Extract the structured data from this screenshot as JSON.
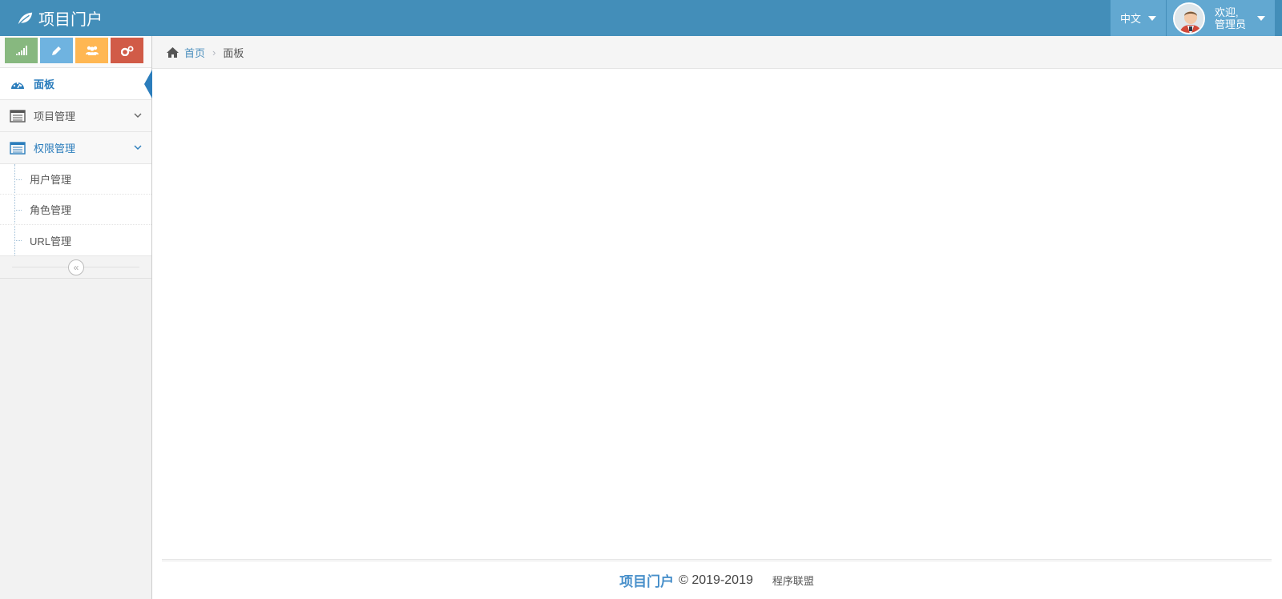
{
  "header": {
    "brand": "项目门户",
    "language": "中文",
    "user_greeting": "欢迎,",
    "user_name": "管理员"
  },
  "shortcuts": [
    {
      "icon": "signal-icon",
      "color": "#87b87f"
    },
    {
      "icon": "pencil-icon",
      "color": "#6fb3e0"
    },
    {
      "icon": "users-icon",
      "color": "#ffb752"
    },
    {
      "icon": "cogs-icon",
      "color": "#d15b47"
    }
  ],
  "sidebar": {
    "items": [
      {
        "label": "面板",
        "icon": "dashboard-icon",
        "active": true
      },
      {
        "label": "项目管理",
        "icon": "list-icon",
        "expanded": false
      },
      {
        "label": "权限管理",
        "icon": "list-icon",
        "expanded": true,
        "children": [
          "用户管理",
          "角色管理",
          "URL管理"
        ]
      }
    ],
    "collapse_icon": "double-angle-left-icon"
  },
  "breadcrumb": {
    "home": "首页",
    "current": "面板"
  },
  "footer": {
    "brand": "项目门户",
    "copyright": "© 2019-2019",
    "org": "程序联盟"
  },
  "colors": {
    "navbar": "#438eb9",
    "navbar_accent": "#62a8d1",
    "active": "#2b7dbc"
  }
}
